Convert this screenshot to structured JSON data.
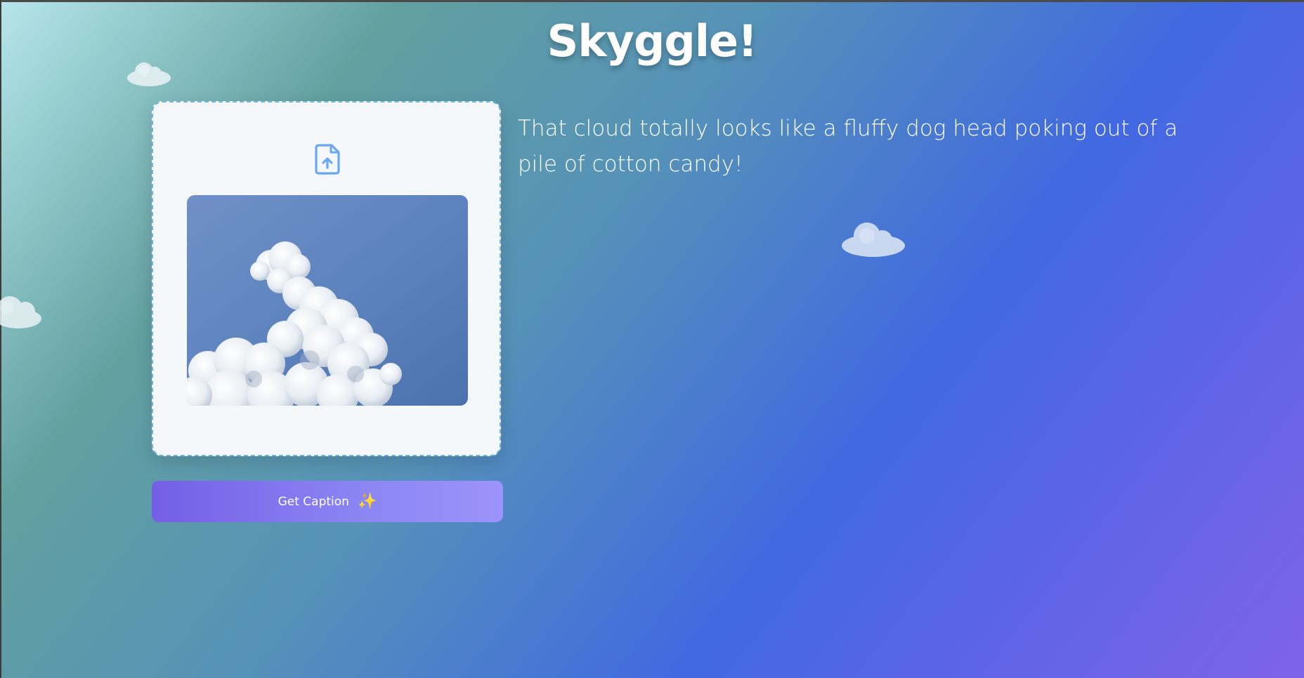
{
  "app": {
    "title": "Skyggle!"
  },
  "upload": {
    "icon": "file-upload-icon",
    "preview_alt": "cloud photo preview"
  },
  "actions": {
    "get_caption_label": "Get Caption",
    "sparkle": "✨"
  },
  "result": {
    "caption": "That cloud totally looks like a fluffy dog head poking out of a pile of cotton candy!"
  },
  "colors": {
    "accent": "#745ee6",
    "upload_icon": "#6aa7f2",
    "card_background": "#f5f8fa"
  }
}
